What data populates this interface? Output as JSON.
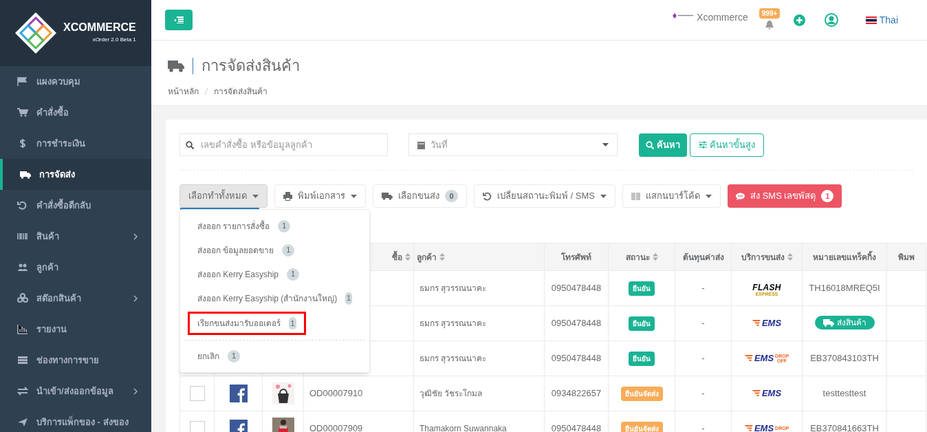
{
  "sidebar": {
    "logo": {
      "name": "XCOMMERCE",
      "subtitle": "xOrder 2.0 Beta 1"
    },
    "items": [
      {
        "label": "แผงควบคุม",
        "selected": false,
        "has_submenu": false
      },
      {
        "label": "คำสั่งซื้อ",
        "selected": false,
        "has_submenu": false
      },
      {
        "label": "การชำระเงิน",
        "selected": false,
        "has_submenu": false
      },
      {
        "label": "การจัดส่ง",
        "selected": true,
        "has_submenu": false
      },
      {
        "label": "คำสั่งซื้อตีกลับ",
        "selected": false,
        "has_submenu": false
      },
      {
        "label": "สินค้า",
        "selected": false,
        "has_submenu": true
      },
      {
        "label": "ลูกค้า",
        "selected": false,
        "has_submenu": false
      },
      {
        "label": "สต๊อกสินค้า",
        "selected": false,
        "has_submenu": true
      },
      {
        "label": "รายงาน",
        "selected": false,
        "has_submenu": false
      },
      {
        "label": "ช่องทางการขาย",
        "selected": false,
        "has_submenu": false
      },
      {
        "label": "นำเข้า/ส่งออกข้อมูล",
        "selected": false,
        "has_submenu": true
      },
      {
        "label": "บริการแพ็กของ - ส่งของ",
        "selected": false,
        "has_submenu": false
      }
    ]
  },
  "header": {
    "brand": "Xcommerce",
    "notification_count": "999+",
    "language": "Thai"
  },
  "page": {
    "title": "การจัดส่งสินค้า",
    "breadcrumb": [
      "หน้าหลัก",
      "การจัดส่งสินค้า"
    ]
  },
  "filters": {
    "search_placeholder": "เลขคำสั่งซื้อ หรือข้อมูลลูกค้า",
    "date_placeholder": "วันที่",
    "search_button": "ค้นหา",
    "advanced_button": "ค้นหาขั้นสูง"
  },
  "actions": [
    {
      "label": "เลือกทำทั้งหมด",
      "kind": "dropdown",
      "expanded": true
    },
    {
      "label": "พิมพ์เอกสาร",
      "kind": "dropdown",
      "expanded": false
    },
    {
      "label": "เลือกขนส่ง",
      "kind": "count",
      "count": "0"
    },
    {
      "label": "เปลี่ยนสถานะพิมพ์ / SMS",
      "kind": "dropdown",
      "expanded": false
    },
    {
      "label": "แสกนบาร์โค้ด",
      "kind": "dropdown",
      "expanded": false
    },
    {
      "label": "ส่ง SMS เลขพัสดุ",
      "kind": "danger",
      "count": "1"
    }
  ],
  "dropdown": {
    "groups": [
      {
        "items": [
          {
            "label": "ส่งออก รายการสั่งซื้อ",
            "count": "1",
            "highlighted": false
          },
          {
            "label": "ส่งออก ข้อมูลยอดขาย",
            "count": "1",
            "highlighted": false
          },
          {
            "label": "ส่งออก Kerry Easyship",
            "count": "1",
            "highlighted": false
          },
          {
            "label": "ส่งออก Kerry Easyship (สำนักงานใหญ่)",
            "count": "1",
            "highlighted": false
          },
          {
            "label": "เรียกขนส่งมารับออเดอร์",
            "count": "1",
            "highlighted": true
          }
        ]
      },
      {
        "items": [
          {
            "label": "ยกเลิก",
            "count": "1",
            "highlighted": false
          }
        ]
      }
    ]
  },
  "table": {
    "columns": [
      {},
      {},
      {},
      {
        "label": "ซื้อ",
        "sortable": true
      },
      {
        "label": "ลูกค้า",
        "sortable": true
      },
      {
        "label": "โทรศัพท์",
        "sortable": false
      },
      {
        "label": "สถานะ",
        "sortable": true
      },
      {
        "label": "ต้นทุนค่าส่ง",
        "sortable": false
      },
      {
        "label": "บริการขนส่ง",
        "sortable": true
      },
      {
        "label": "หมายเลขแทร็คกิ้ง",
        "sortable": false
      },
      {
        "label": "พิมพ",
        "sortable": false
      }
    ],
    "rows": [
      {
        "customer": "ธมกร สุวรรณนาคะ",
        "phone": "0950478448",
        "status": {
          "label": "ยืนยัน",
          "color": "#1ab394"
        },
        "cost": "-",
        "carrier": {
          "kind": "flash",
          "label": "FLASH",
          "sub": "EXPRESS"
        },
        "tracking": {
          "kind": "text",
          "label": "TH16018MREQ5I"
        }
      },
      {
        "customer": "ธมกร สุวรรณนาคะ",
        "phone": "0950478448",
        "status": {
          "label": "ยืนยัน",
          "color": "#1ab394"
        },
        "cost": "-",
        "carrier": {
          "kind": "ems",
          "label": "EMS"
        },
        "tracking": {
          "kind": "button",
          "label": "ส่งสินค้า"
        }
      },
      {
        "customer": "ธมกร สุวรรณนาคะ",
        "phone": "0950478448",
        "status": {
          "label": "ยืนยัน",
          "color": "#1ab394"
        },
        "cost": "-",
        "carrier": {
          "kind": "ems",
          "label": "EMS",
          "sub": "DROP OFF"
        },
        "tracking": {
          "kind": "text",
          "label": "EB370843103TH"
        }
      },
      {
        "checked": false,
        "order": "OD00007910",
        "customer": "วุฒิชัย วัชระโกมล",
        "phone": "0934822657",
        "status": {
          "label": "ยืนยันจัดส่ง",
          "color": "#f8ac59"
        },
        "cost": "-",
        "carrier": {
          "kind": "ems",
          "label": "EMS"
        },
        "tracking": {
          "kind": "text",
          "label": "testtesttest"
        }
      },
      {
        "checked": false,
        "order": "OD00007909",
        "customer": "Thamakorn Suwannaka",
        "phone": "0950478448",
        "status": {
          "label": "ยืนยันจัดส่ง",
          "color": "#f8ac59"
        },
        "cost": "-",
        "carrier": {
          "kind": "ems",
          "label": "EMS",
          "sub": "DROP"
        },
        "tracking": {
          "kind": "text",
          "label": "EB370841663TH"
        }
      }
    ]
  }
}
